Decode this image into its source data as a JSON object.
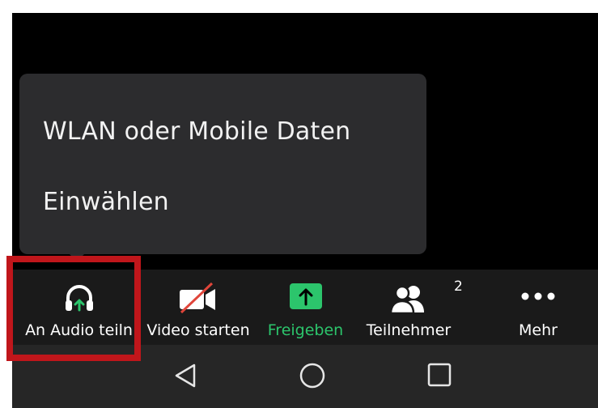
{
  "audio_menu": {
    "items": [
      {
        "label": "WLAN oder Mobile Daten"
      },
      {
        "label": "Einwählen"
      }
    ]
  },
  "toolbar": {
    "audio_label": "An Audio teiln",
    "video_label": "Video starten",
    "share_label": "Freigeben",
    "participants_label": "Teilnehmer",
    "participants_count": "2",
    "more_label": "Mehr"
  },
  "colors": {
    "accent_green": "#2cc56c",
    "video_off_red": "#e0453a",
    "highlight_red": "#c0161b"
  },
  "icons": {
    "audio": "headphones-icon",
    "video": "video-off-icon",
    "share": "share-up-arrow-icon",
    "participants": "participants-icon",
    "more": "more-dots-icon",
    "nav_back": "back-triangle-icon",
    "nav_home": "home-circle-icon",
    "nav_recents": "recents-square-icon"
  }
}
